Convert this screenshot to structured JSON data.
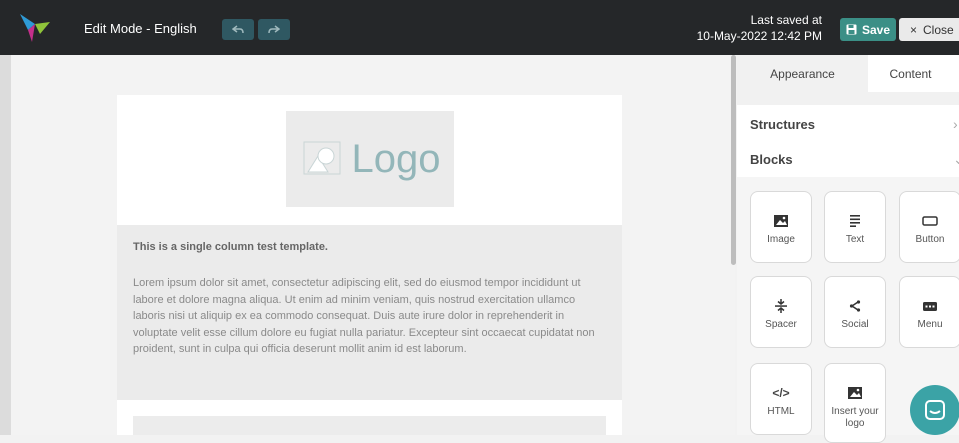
{
  "topbar": {
    "mode_label": "Edit Mode - English",
    "last_saved_line1": "Last saved at",
    "last_saved_line2": "10-May-2022 12:42 PM",
    "save_label": "Save",
    "close_label": "Close",
    "brand_colors": [
      "#2e9ad6",
      "#8fc43a",
      "#c52f8b"
    ]
  },
  "email": {
    "logo_text": "Logo",
    "title": "This is a single column test template.",
    "body": "Lorem ipsum dolor sit amet, consectetur adipiscing elit, sed do eiusmod tempor incididunt ut labore et dolore magna aliqua. Ut enim ad minim veniam, quis nostrud exercitation ullamco laboris nisi ut aliquip ex ea commodo consequat. Duis aute irure dolor in reprehenderit in voluptate velit esse cillum dolore eu fugiat nulla pariatur. Excepteur sint occaecat cupidatat non proident, sunt in culpa qui officia deserunt mollit anim id est laborum."
  },
  "panel": {
    "tabs": [
      "Appearance",
      "Content"
    ],
    "sections": [
      "Structures",
      "Blocks"
    ],
    "blocks": [
      {
        "label": "Image",
        "icon": "image-icon"
      },
      {
        "label": "Text",
        "icon": "text-icon"
      },
      {
        "label": "Button",
        "icon": "button-icon"
      },
      {
        "label": "Spacer",
        "icon": "spacer-icon"
      },
      {
        "label": "Social",
        "icon": "share-icon"
      },
      {
        "label": "Menu",
        "icon": "menu-icon"
      },
      {
        "label": "HTML",
        "icon": "code-icon"
      },
      {
        "label": "Insert your logo",
        "icon": "image-icon"
      }
    ]
  },
  "colors": {
    "topbar": "#252729",
    "save": "#3b8f86",
    "chat": "#3ba3a6"
  }
}
